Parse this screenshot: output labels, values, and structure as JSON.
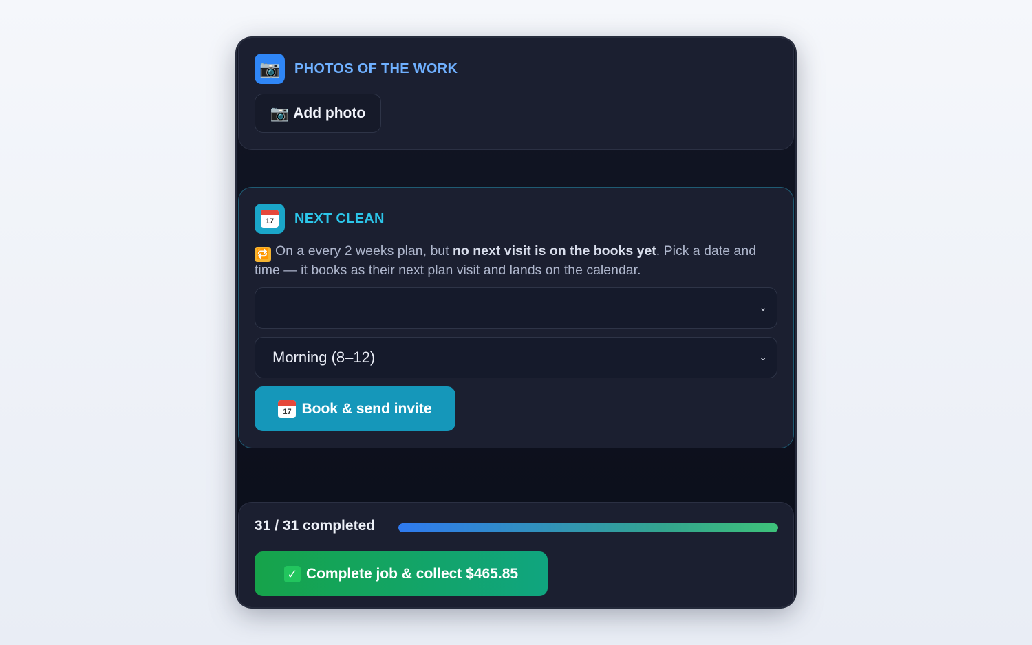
{
  "photos_section": {
    "title": "PHOTOS OF THE WORK",
    "icon": "camera-icon",
    "add_button_label": "Add photo"
  },
  "next_clean": {
    "title": "NEXT CLEAN",
    "icon": "calendar-icon",
    "calendar_day": "17",
    "desc_prefix": "On a every 2 weeks plan, but ",
    "desc_bold": "no next visit is on the books yet",
    "desc_suffix": ". Pick a date and time — it books as their next plan visit and lands on the calendar.",
    "date_select_value": "",
    "time_select_value": "Morning (8–12)",
    "book_button_label": "Book & send invite"
  },
  "progress": {
    "label": "31 / 31 completed",
    "completed": 31,
    "total": 31,
    "fraction": 1.0
  },
  "complete_button_label": "Complete job & collect $465.85",
  "colors": {
    "blue_accent": "#2f86f6",
    "teal_accent": "#1aa6c9",
    "green_accent": "#16a34a"
  }
}
